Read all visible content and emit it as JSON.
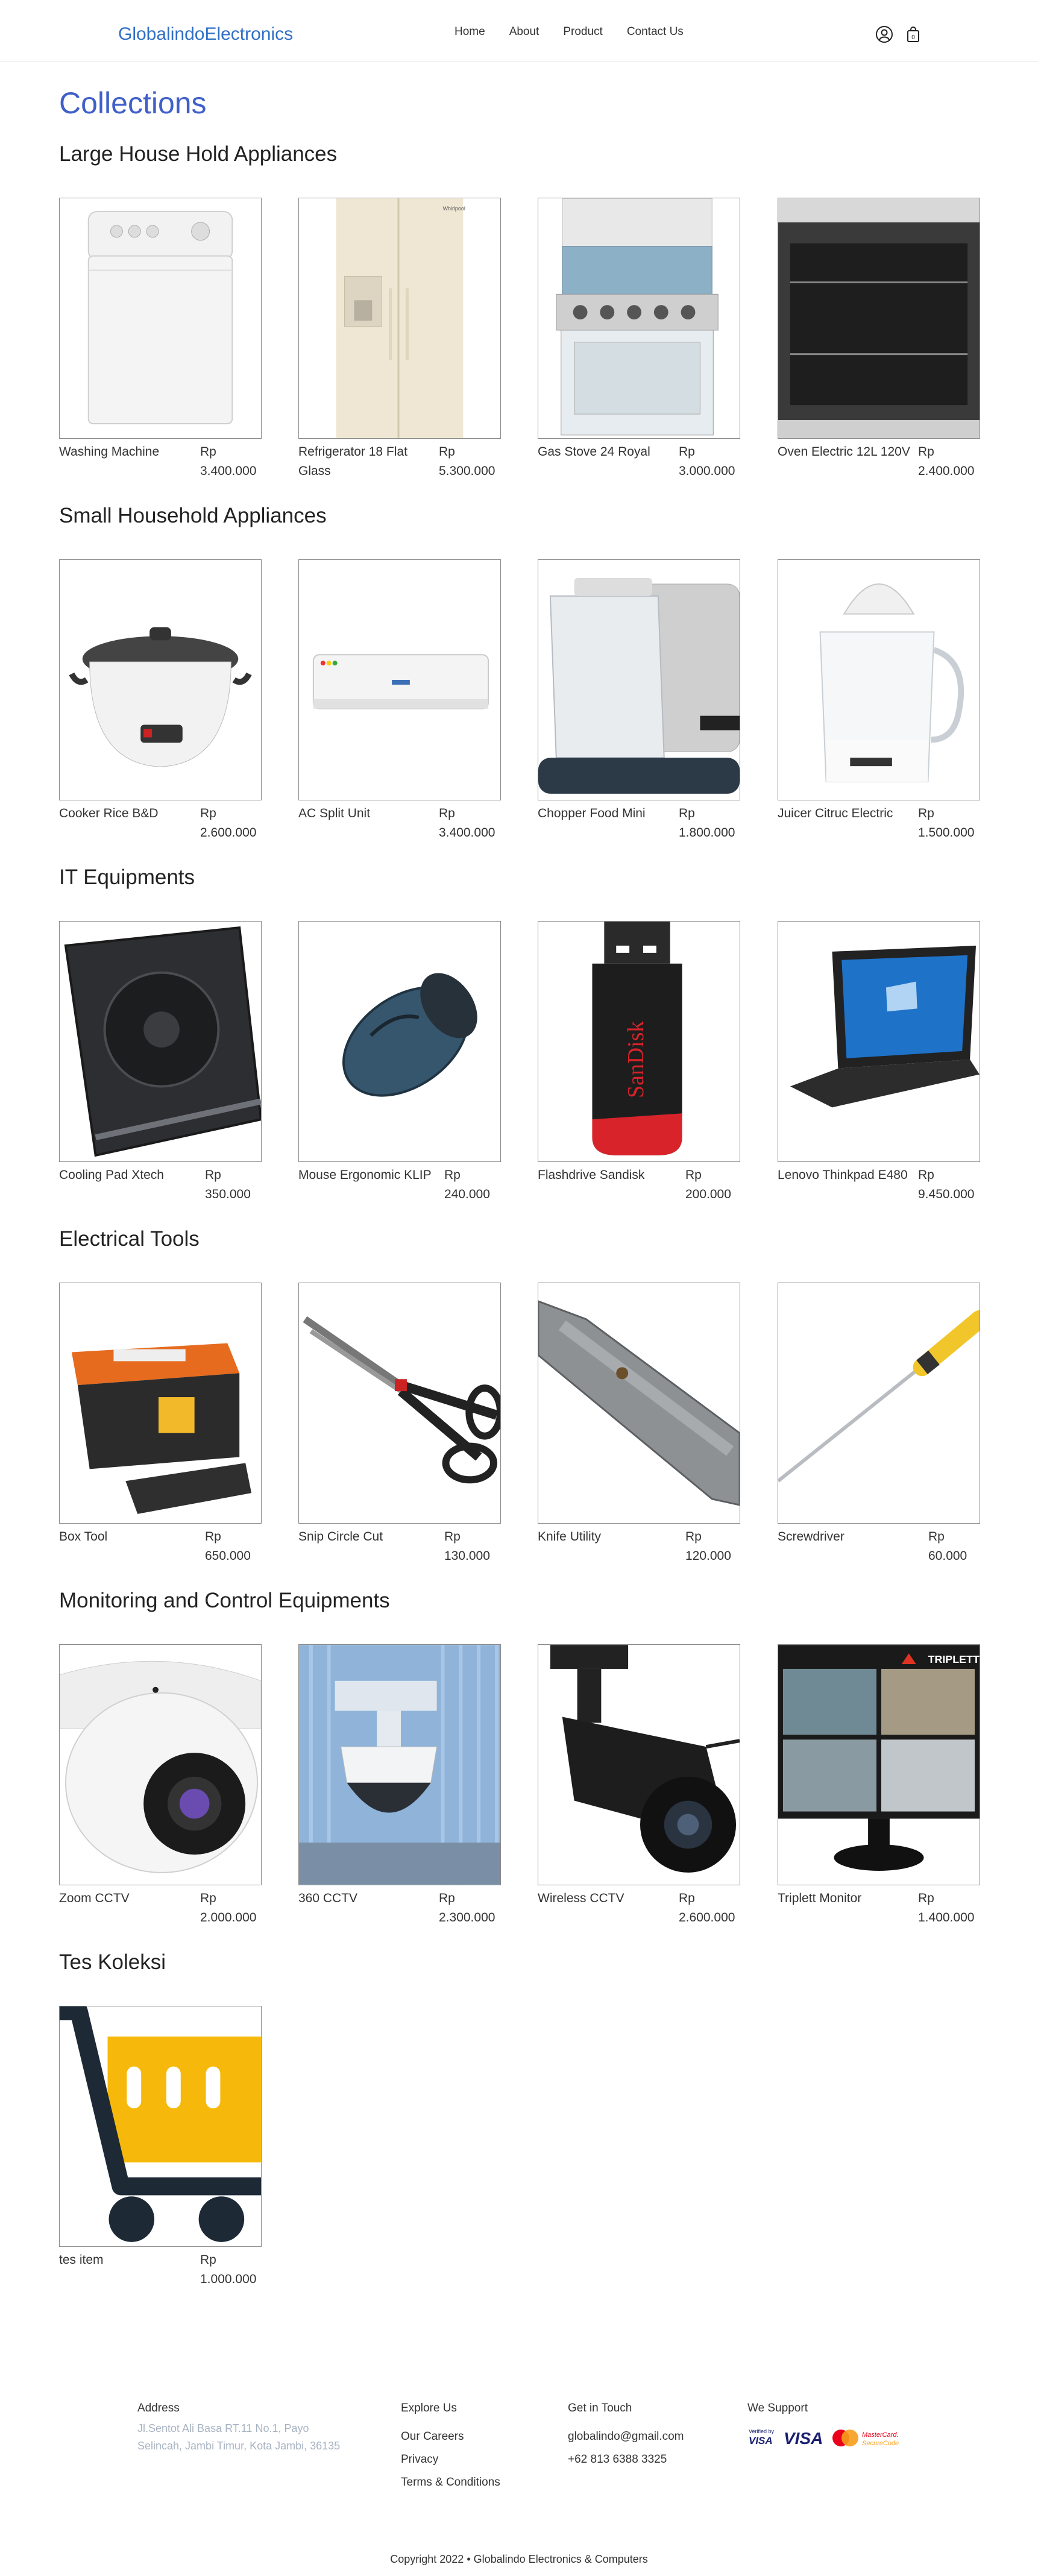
{
  "header": {
    "brand": "GlobalindoElectronics",
    "nav": [
      "Home",
      "About",
      "Product",
      "Contact Us"
    ]
  },
  "page_title": "Collections",
  "sections": [
    {
      "title": "Large House Hold Appliances",
      "products": [
        {
          "name": "Washing Machine",
          "price": "Rp\n3.400.000",
          "image": "washing-machine-image"
        },
        {
          "name": "Refrigerator 18 Flat Glass",
          "price": "Rp\n5.300.000",
          "image": "refrigerator-image"
        },
        {
          "name": "Gas Stove 24 Royal",
          "price": "Rp\n3.000.000",
          "image": "gas-stove-image"
        },
        {
          "name": "Oven Electric 12L 120V",
          "price": "Rp\n2.400.000",
          "image": "oven-image"
        }
      ]
    },
    {
      "title": "Small Household Appliances",
      "products": [
        {
          "name": "Cooker Rice B&D",
          "price": "Rp\n2.600.000",
          "image": "rice-cooker-image"
        },
        {
          "name": "AC Split Unit",
          "price": "Rp\n3.400.000",
          "image": "ac-split-image"
        },
        {
          "name": "Chopper Food Mini",
          "price": "Rp\n1.800.000",
          "image": "food-chopper-image"
        },
        {
          "name": "Juicer Citruc Electric",
          "price": "Rp\n1.500.000",
          "image": "juicer-image"
        }
      ]
    },
    {
      "title": "IT Equipments",
      "products": [
        {
          "name": "Cooling Pad Xtech",
          "price": "Rp\n350.000",
          "image": "cooling-pad-image"
        },
        {
          "name": "Mouse Ergonomic KLIP",
          "price": "Rp\n240.000",
          "image": "mouse-image"
        },
        {
          "name": "Flashdrive Sandisk",
          "price": "Rp\n200.000",
          "image": "flashdrive-image"
        },
        {
          "name": "Lenovo Thinkpad E480",
          "price": "Rp\n9.450.000",
          "image": "laptop-image"
        }
      ]
    },
    {
      "title": "Electrical Tools",
      "products": [
        {
          "name": "Box Tool",
          "price": "Rp\n650.000",
          "image": "tool-box-image"
        },
        {
          "name": "Snip Circle Cut",
          "price": "Rp\n130.000",
          "image": "snips-image"
        },
        {
          "name": "Knife Utility",
          "price": "Rp\n120.000",
          "image": "utility-knife-image"
        },
        {
          "name": "Screwdriver",
          "price": "Rp\n60.000",
          "image": "screwdriver-image"
        }
      ]
    },
    {
      "title": "Monitoring and Control Equipments",
      "products": [
        {
          "name": "Zoom CCTV",
          "price": "Rp\n2.000.000",
          "image": "dome-cctv-image"
        },
        {
          "name": "360 CCTV",
          "price": "Rp\n2.300.000",
          "image": "ptz-cctv-image"
        },
        {
          "name": "Wireless CCTV",
          "price": "Rp\n2.600.000",
          "image": "bullet-cctv-image"
        },
        {
          "name": "Triplett Monitor",
          "price": "Rp\n1.400.000",
          "image": "monitor-image"
        }
      ]
    },
    {
      "title": "Tes Koleksi",
      "products": [
        {
          "name": "tes item",
          "price": "Rp\n1.000.000",
          "image": "cart-image"
        }
      ]
    }
  ],
  "footer": {
    "address_title": "Address",
    "address": "Jl.Sentot Ali Basa RT.11 No.1, Payo Selincah, Jambi Timur, Kota Jambi, 36135",
    "explore_title": "Explore Us",
    "explore_links": [
      "Our Careers",
      "Privacy",
      "Terms & Conditions"
    ],
    "contact_title": "Get in Touch",
    "email": "globalindo@gmail.com",
    "phone": "+62 813 6388 3325",
    "support_title": "We Support",
    "copyright": "Copyright 2022 • Globalindo Electronics & Computers"
  }
}
